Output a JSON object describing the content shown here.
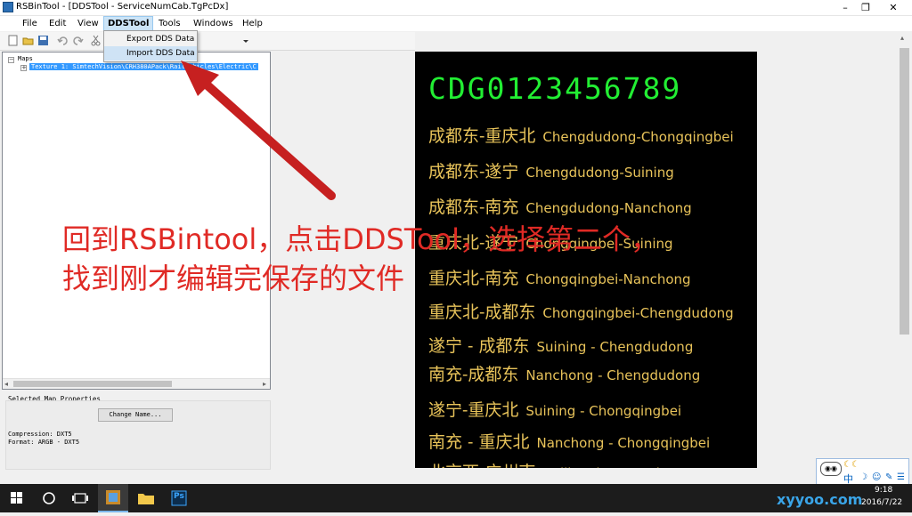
{
  "window": {
    "title": "RSBinTool - [DDSTool - ServiceNumCab.TgPcDx]",
    "min_glyph": "–",
    "restore_glyph": "❐",
    "close_glyph": "✕"
  },
  "menu": {
    "items": [
      "File",
      "Edit",
      "View",
      "DDSTool",
      "Tools",
      "Windows",
      "Help"
    ],
    "dropdown": [
      "Export DDS Data",
      "Import DDS Data"
    ]
  },
  "tree": {
    "root": "Maps",
    "child": "Texture 1: SimtechVision\\CRH380APack\\RailVehicles\\Electric\\C"
  },
  "properties": {
    "heading": "Selected Map Properties",
    "button": "Change Name...",
    "compression": "Compression: DXT5",
    "format": "Format: ARGB - DXT5"
  },
  "texture": {
    "digits": "CDG0123456789",
    "routes": [
      {
        "zh": "成都东-重庆北",
        "en": "Chengdudong-Chongqingbei"
      },
      {
        "zh": "成都东-遂宁",
        "en": "Chengdudong-Suining"
      },
      {
        "zh": "成都东-南充",
        "en": "Chengdudong-Nanchong"
      },
      {
        "zh": "重庆北-遂宁",
        "en": "Chongqingbei-Suining"
      },
      {
        "zh": "重庆北-南充",
        "en": "Chongqingbei-Nanchong"
      },
      {
        "zh": "重庆北-成都东",
        "en": "Chongqingbei-Chengdudong"
      },
      {
        "zh": "遂宁 -  成都东",
        "en": "Suining - Chengdudong"
      },
      {
        "zh": "南充-成都东",
        "en": "Nanchong - Chengdudong"
      },
      {
        "zh": "遂宁-重庆北",
        "en": "Suining - Chongqingbei"
      },
      {
        "zh": "南充 - 重庆北",
        "en": "Nanchong - Chongqingbei"
      },
      {
        "zh": "北京西-广州南",
        "en": "Beijingxi-Guangzhounan"
      }
    ]
  },
  "annotation": {
    "line1": "回到RSBintool，点击DDSTool，选择第二个，",
    "line2": "找到刚才编辑完保存的文件"
  },
  "taskbar": {
    "time": "9:18",
    "date": "2016/7/22",
    "ps_label": "Ps",
    "ime": "中"
  },
  "watermark": "xyyoo.com",
  "colors": {
    "digits": "#22ee33",
    "routes": "#e8c35a",
    "annotation": "#e02a25",
    "arrow": "#c62020"
  }
}
